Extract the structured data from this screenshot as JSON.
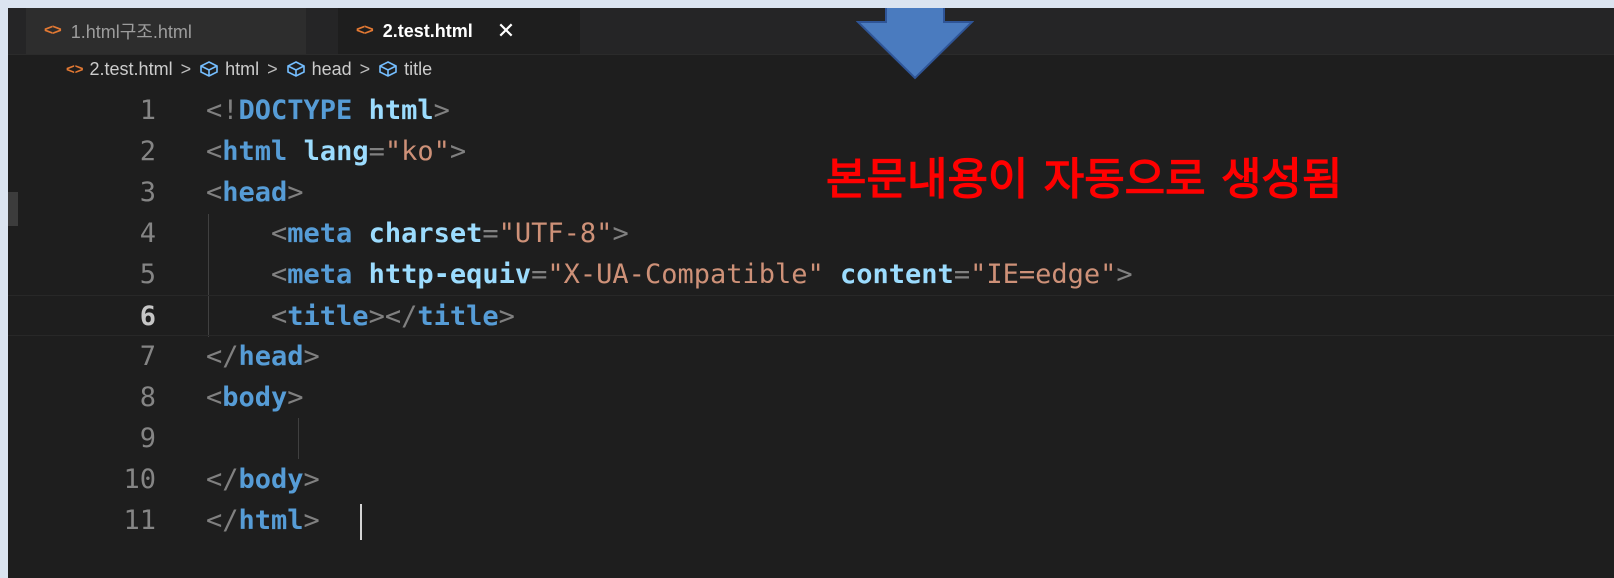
{
  "tabs": [
    {
      "label": "1.html구조.html",
      "icon": "html-file-icon"
    },
    {
      "label": "2.test.html",
      "icon": "html-file-icon",
      "close": "✕"
    }
  ],
  "breadcrumb": {
    "file": "2.test.html",
    "items": [
      "html",
      "head",
      "title"
    ],
    "separator": ">"
  },
  "annotation": "본문내용이 자동으로 생성됨",
  "lines": [
    {
      "n": "1",
      "tokens": [
        [
          "b",
          "<!"
        ],
        [
          "t",
          "DOCTYPE"
        ],
        [
          "b",
          " "
        ],
        [
          "a",
          "html"
        ],
        [
          "b",
          ">"
        ]
      ]
    },
    {
      "n": "2",
      "tokens": [
        [
          "b",
          "<"
        ],
        [
          "t",
          "html"
        ],
        [
          "b",
          " "
        ],
        [
          "a",
          "lang"
        ],
        [
          "b",
          "="
        ],
        [
          "s",
          "\"ko\""
        ],
        [
          "b",
          ">"
        ]
      ]
    },
    {
      "n": "3",
      "tokens": [
        [
          "b",
          "<"
        ],
        [
          "t",
          "head"
        ],
        [
          "b",
          ">"
        ]
      ]
    },
    {
      "n": "4",
      "tokens": [
        [
          "b",
          "    <"
        ],
        [
          "t",
          "meta"
        ],
        [
          "b",
          " "
        ],
        [
          "a",
          "charset"
        ],
        [
          "b",
          "="
        ],
        [
          "s",
          "\"UTF-8\""
        ],
        [
          "b",
          ">"
        ]
      ]
    },
    {
      "n": "5",
      "tokens": [
        [
          "b",
          "    <"
        ],
        [
          "t",
          "meta"
        ],
        [
          "b",
          " "
        ],
        [
          "a",
          "http-equiv"
        ],
        [
          "b",
          "="
        ],
        [
          "s",
          "\"X-UA-Compatible\""
        ],
        [
          "b",
          " "
        ],
        [
          "a",
          "content"
        ],
        [
          "b",
          "="
        ],
        [
          "s",
          "\"IE=edge\""
        ],
        [
          "b",
          ">"
        ]
      ]
    },
    {
      "n": "6",
      "tokens": [
        [
          "b",
          "    <"
        ],
        [
          "t",
          "title"
        ],
        [
          "b",
          "></"
        ],
        [
          "t",
          "title"
        ],
        [
          "b",
          ">"
        ]
      ]
    },
    {
      "n": "7",
      "tokens": [
        [
          "b",
          "</"
        ],
        [
          "t",
          "head"
        ],
        [
          "b",
          ">"
        ]
      ]
    },
    {
      "n": "8",
      "tokens": [
        [
          "b",
          "<"
        ],
        [
          "t",
          "body"
        ],
        [
          "b",
          ">"
        ]
      ]
    },
    {
      "n": "9",
      "tokens": []
    },
    {
      "n": "10",
      "tokens": [
        [
          "b",
          "</"
        ],
        [
          "t",
          "body"
        ],
        [
          "b",
          ">"
        ]
      ]
    },
    {
      "n": "11",
      "tokens": [
        [
          "b",
          "</"
        ],
        [
          "t",
          "html"
        ],
        [
          "b",
          ">"
        ]
      ]
    }
  ],
  "current_line": "6",
  "colors": {
    "editor_bg": "#1e1e1e",
    "tag": "#569cd6",
    "attribute": "#9cdcfe",
    "string": "#ce9178",
    "bracket": "#808080",
    "annotation": "#ff0000",
    "arrow": "#4a7bbf"
  }
}
